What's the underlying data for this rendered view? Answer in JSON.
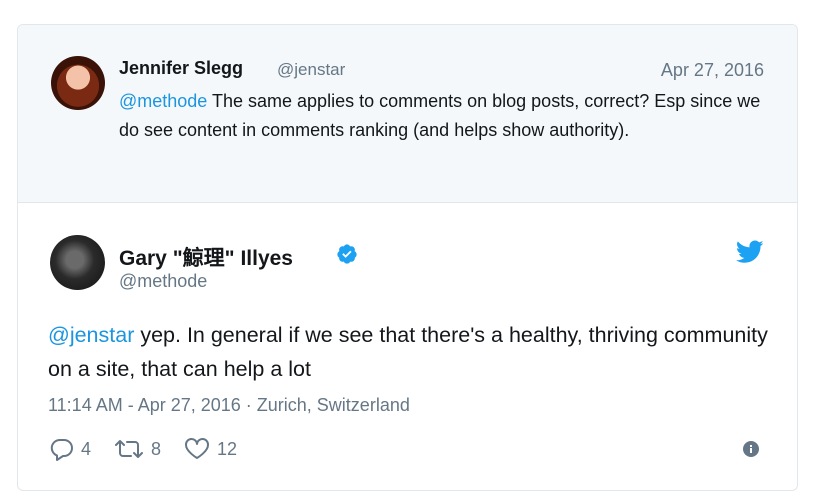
{
  "parent_tweet": {
    "name": "Jennifer Slegg",
    "handle": "@jenstar",
    "date": "Apr 27, 2016",
    "mention": "@methode",
    "text": " The same applies to comments on blog posts, correct? Esp since we do see content in comments ranking (and helps show authority)."
  },
  "main_tweet": {
    "name": "Gary \"鯨理\" Illyes",
    "handle": "@methode",
    "mention": "@jenstar",
    "text": " yep. In general if we see that there's a healthy, thriving community on a site, that can help a lot",
    "meta": "11:14 AM - Apr 27, 2016 · Zurich, Switzerland",
    "replies": "4",
    "retweets": "8",
    "likes": "12"
  },
  "icons": {
    "verified": "verified-badge-icon",
    "brand": "twitter-bird-icon",
    "reply": "reply-icon",
    "retweet": "retweet-icon",
    "like": "heart-icon",
    "info": "info-icon"
  },
  "colors": {
    "accent": "#1b95e0",
    "secondary_text": "#657786",
    "parent_bg": "#f5f8fa"
  }
}
